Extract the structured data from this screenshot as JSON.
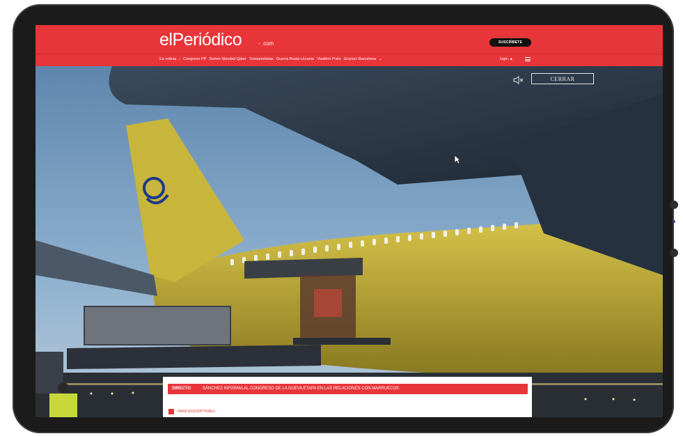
{
  "header": {
    "logo": "elPeriódico",
    "logo_suffix": "- .com",
    "subscribe_label": "SUSCRÍBETE",
    "nav_items": [
      "Es noticia",
      "›",
      "Congreso PP",
      "Sorteo Mundial Qatar",
      "Transportistas",
      "Guerra Rusia-Ucrania",
      "Vladimir Putin",
      "Granizo Barcelona",
      "⌄"
    ],
    "login_label": "login"
  },
  "video": {
    "close_label": "CERRAR",
    "mute_icon": "speaker-muted-icon"
  },
  "card": {
    "live_tag": "DIRECTO",
    "live_headline": "SÁNCHEZ INFORMA AL CONGRESO DE LA NUEVA ETAPA EN LAS RELACIONES CON MARRUECOS",
    "subscribers_label": "PARA SUSCRIPTORES"
  },
  "colors": {
    "brand_red": "#e8353a",
    "plane_yellow": "#c9b33a",
    "sky": "#7fa3c4"
  }
}
